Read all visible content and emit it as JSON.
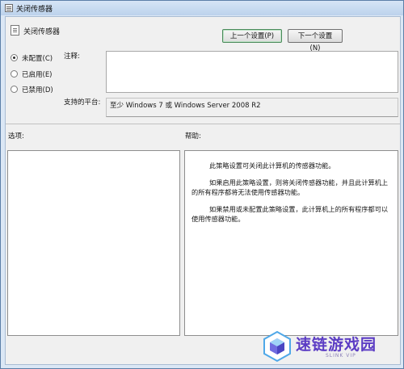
{
  "window": {
    "title": "关闭传感器"
  },
  "setting": {
    "name": "关闭传感器"
  },
  "nav": {
    "prev_label": "上一个设置(P)",
    "next_label": "下一个设置(N)"
  },
  "state_options": [
    {
      "label": "未配置(C)",
      "checked": true
    },
    {
      "label": "已启用(E)",
      "checked": false
    },
    {
      "label": "已禁用(D)",
      "checked": false
    }
  ],
  "comment": {
    "label": "注释:",
    "value": ""
  },
  "platform": {
    "label": "支持的平台:",
    "value": "至少 Windows 7 或 Windows Server 2008 R2"
  },
  "options": {
    "label": "选项:"
  },
  "help": {
    "label": "帮助:",
    "paragraphs": [
      "此策略设置可关闭此计算机的传感器功能。",
      "如果启用此策略设置，则将关闭传感器功能，并且此计算机上的所有程序都将无法使用传感器功能。",
      "如果禁用或未配置此策略设置，此计算机上的所有程序都可以使用传感器功能。"
    ]
  },
  "watermark": {
    "text": "速链游戏园",
    "subtext": "SLINK VIP",
    "color": "#5b3cc4"
  }
}
